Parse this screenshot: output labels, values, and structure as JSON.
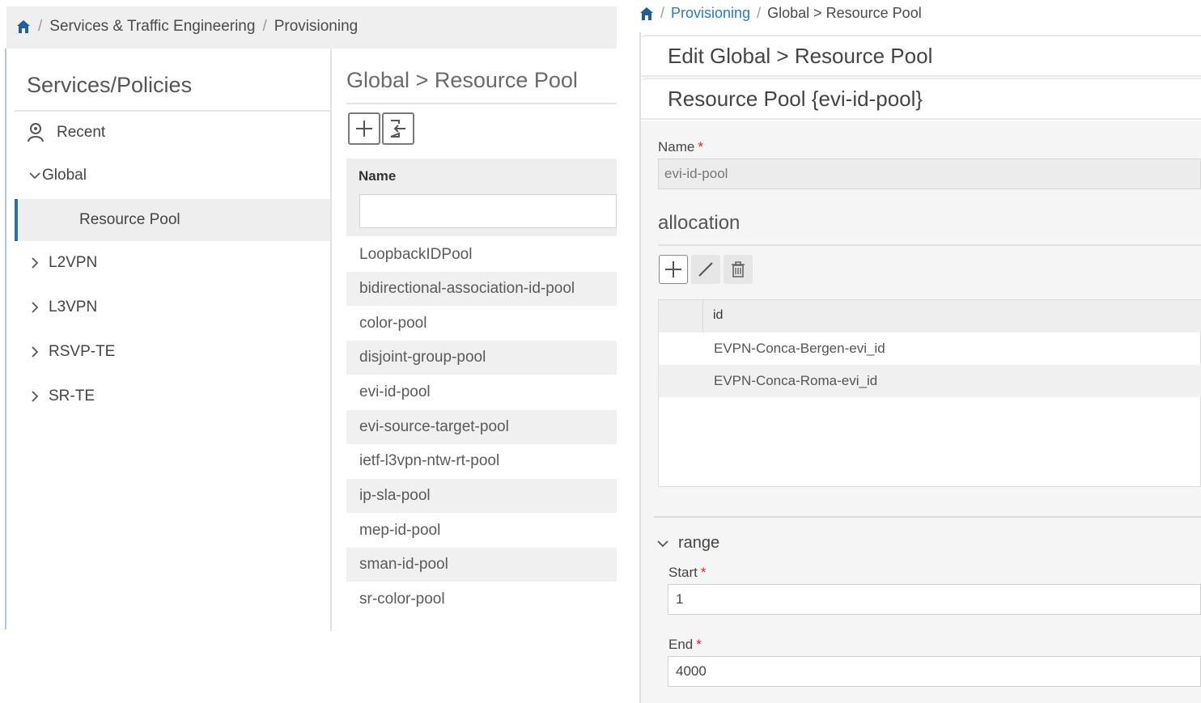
{
  "left": {
    "breadcrumb": [
      "Services & Traffic Engineering",
      "Provisioning"
    ],
    "sidebar": {
      "title": "Services/Policies",
      "items": [
        {
          "label": "Recent"
        },
        {
          "label": "Global"
        },
        {
          "label": "Resource Pool"
        },
        {
          "label": "L2VPN"
        },
        {
          "label": "L3VPN"
        },
        {
          "label": "RSVP-TE"
        },
        {
          "label": "SR-TE"
        }
      ]
    },
    "list": {
      "title": "Global > Resource Pool",
      "column": "Name",
      "filter_value": "",
      "rows": [
        "LoopbackIDPool",
        "bidirectional-association-id-pool",
        "color-pool",
        "disjoint-group-pool",
        "evi-id-pool",
        "evi-source-target-pool",
        "ietf-l3vpn-ntw-rt-pool",
        "ip-sla-pool",
        "mep-id-pool",
        "sman-id-pool",
        "sr-color-pool"
      ]
    }
  },
  "right": {
    "breadcrumb": {
      "link": "Provisioning",
      "current": "Global > Resource Pool"
    },
    "edit_title": "Edit Global > Resource Pool",
    "pool_title": "Resource Pool {evi-id-pool}",
    "name_label": "Name",
    "required_mark": "*",
    "name_value": "evi-id-pool",
    "allocation_title": "allocation",
    "allocation_column": "id",
    "allocation_rows": [
      "EVPN-Conca-Bergen-evi_id",
      "EVPN-Conca-Roma-evi_id"
    ],
    "range_title": "range",
    "start_label": "Start",
    "start_value": "1",
    "end_label": "End",
    "end_value": "4000"
  },
  "icons": {
    "home": "home-icon",
    "recent": "recent-user-icon",
    "add": "plus-icon",
    "import": "import-icon",
    "edit": "pencil-icon",
    "delete": "trash-icon"
  },
  "colors": {
    "accent": "#2b6fa8",
    "link": "#2b7bbf",
    "required": "#d0262b"
  }
}
